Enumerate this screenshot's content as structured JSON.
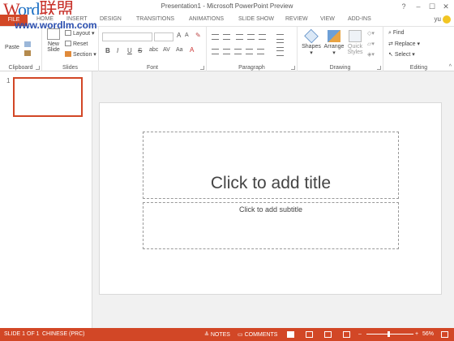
{
  "window": {
    "title": "Presentation1 - Microsoft PowerPoint Preview",
    "user": "yu",
    "controls": [
      "?",
      "–",
      "☐",
      "✕"
    ]
  },
  "watermark": {
    "brand_part1": "W",
    "brand_part2": "ord",
    "brand_part3": "联盟",
    "url": "www.wordlm.com"
  },
  "tabs": [
    "FILE",
    "HOME",
    "INSERT",
    "DESIGN",
    "TRANSITIONS",
    "ANIMATIONS",
    "SLIDE SHOW",
    "REVIEW",
    "VIEW",
    "ADD-INS"
  ],
  "ribbon": {
    "clipboard": {
      "label": "Clipboard",
      "paste": "Paste"
    },
    "slides": {
      "label": "Slides",
      "new_slide_line1": "New",
      "new_slide_line2": "Slide",
      "layout": "Layout",
      "reset": "Reset",
      "section": "Section"
    },
    "font": {
      "label": "Font",
      "bold": "B",
      "italic": "I",
      "underline": "U",
      "strike": "S",
      "grow": "A",
      "shrink": "A"
    },
    "paragraph": {
      "label": "Paragraph"
    },
    "drawing": {
      "label": "Drawing",
      "shapes": "Shapes",
      "arrange": "Arrange",
      "quick_styles_line1": "Quick",
      "quick_styles_line2": "Styles"
    },
    "editing": {
      "label": "Editing",
      "find": "Find",
      "replace": "Replace",
      "select": "Select"
    }
  },
  "thumbnails": [
    {
      "number": "1"
    }
  ],
  "slide": {
    "title_placeholder": "Click to add title",
    "subtitle_placeholder": "Click to add subtitle"
  },
  "statusbar": {
    "slide_info": "SLIDE 1 OF 1",
    "language": "CHINESE (PRC)",
    "notes": "NOTES",
    "comments": "COMMENTS",
    "zoom": "56%"
  },
  "colors": {
    "accent": "#d24726",
    "watermark_red": "#c8312a",
    "watermark_blue": "#1b6fc4"
  }
}
